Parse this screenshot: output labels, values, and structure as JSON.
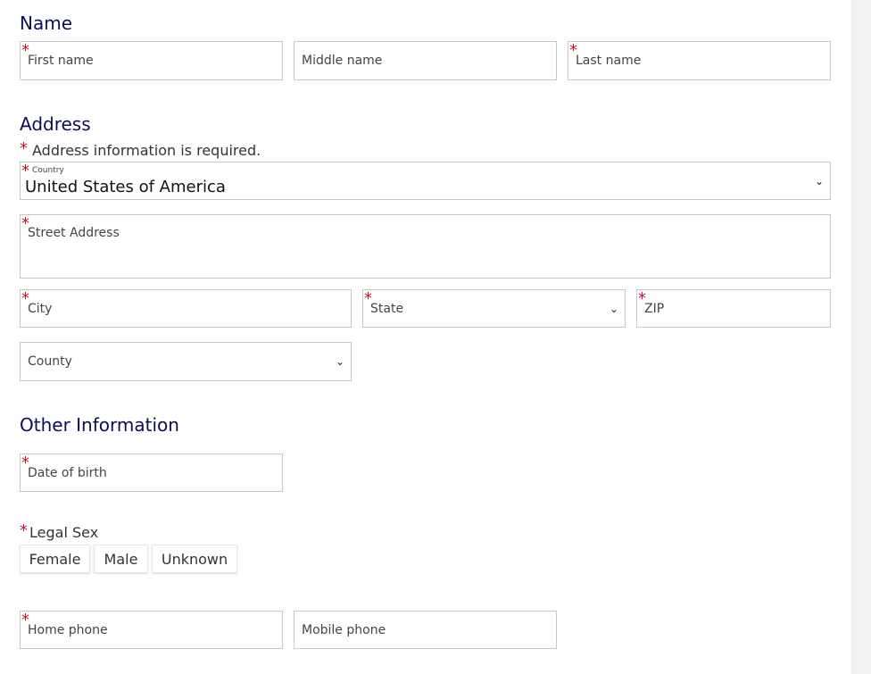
{
  "sections": {
    "name": "Name",
    "address": "Address",
    "other": "Other Information"
  },
  "name": {
    "first": "First name",
    "middle": "Middle name",
    "last": "Last name"
  },
  "address": {
    "required_note": "Address information is required.",
    "country_label": "Country",
    "country_value": "United States of America",
    "street": "Street Address",
    "city": "City",
    "state": "State",
    "zip": "ZIP",
    "county": "County"
  },
  "other": {
    "dob": "Date of birth",
    "legal_sex_label": "Legal Sex",
    "sex_options": [
      "Female",
      "Male",
      "Unknown"
    ],
    "home_phone": "Home phone",
    "mobile_phone": "Mobile phone"
  },
  "required_marker": "*",
  "dropdown_glyph": "⌄",
  "colors": {
    "heading": "#0d0d57",
    "required": "#c8102e",
    "border": "#c8c8c8",
    "background": "#f2f2f2"
  }
}
